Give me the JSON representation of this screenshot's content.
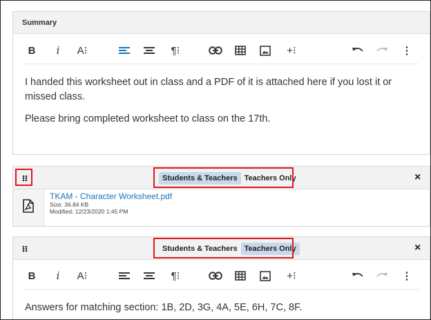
{
  "summary": {
    "title": "Summary",
    "paragraphs": [
      "I handed this worksheet out in class and a PDF of it is attached here if you lost it or missed class.",
      "Please bring completed worksheet to class on the 17th."
    ]
  },
  "toolbar": {
    "bold": "B",
    "italic": "i",
    "font_size": "A⁝",
    "paragraph": "¶⁝",
    "insert": "+⁝",
    "more": "⋮",
    "icons": [
      "bold-icon",
      "italic-icon",
      "font-size-icon",
      "align-left-icon",
      "align-center-icon",
      "paragraph-format-icon",
      "link-icon",
      "table-icon",
      "image-icon",
      "insert-more-icon",
      "undo-icon",
      "redo-icon",
      "more-vert-icon"
    ]
  },
  "attachment_block": {
    "visibility": {
      "option_all": "Students & Teachers",
      "option_teachers": "Teachers Only",
      "selected": "Students & Teachers"
    },
    "close": "×",
    "file": {
      "name": "TKAM - Character Worksheet.pdf",
      "size": "Size: 36.84 KB",
      "modified": "Modified: 12/23/2020 1:45 PM",
      "icon": "pdf-file-icon"
    }
  },
  "text_block": {
    "visibility": {
      "option_all": "Students & Teachers",
      "option_teachers": "Teachers Only",
      "selected": "Teachers Only"
    },
    "close": "×",
    "content": "Answers for matching section: 1B, 2D, 3G, 4A, 5E, 6H, 7C, 8F."
  },
  "colors": {
    "highlight_border": "#e0161b",
    "active_toggle": "#c7d9ea",
    "align_active": "#1a73b8",
    "link": "#1a73b8"
  }
}
